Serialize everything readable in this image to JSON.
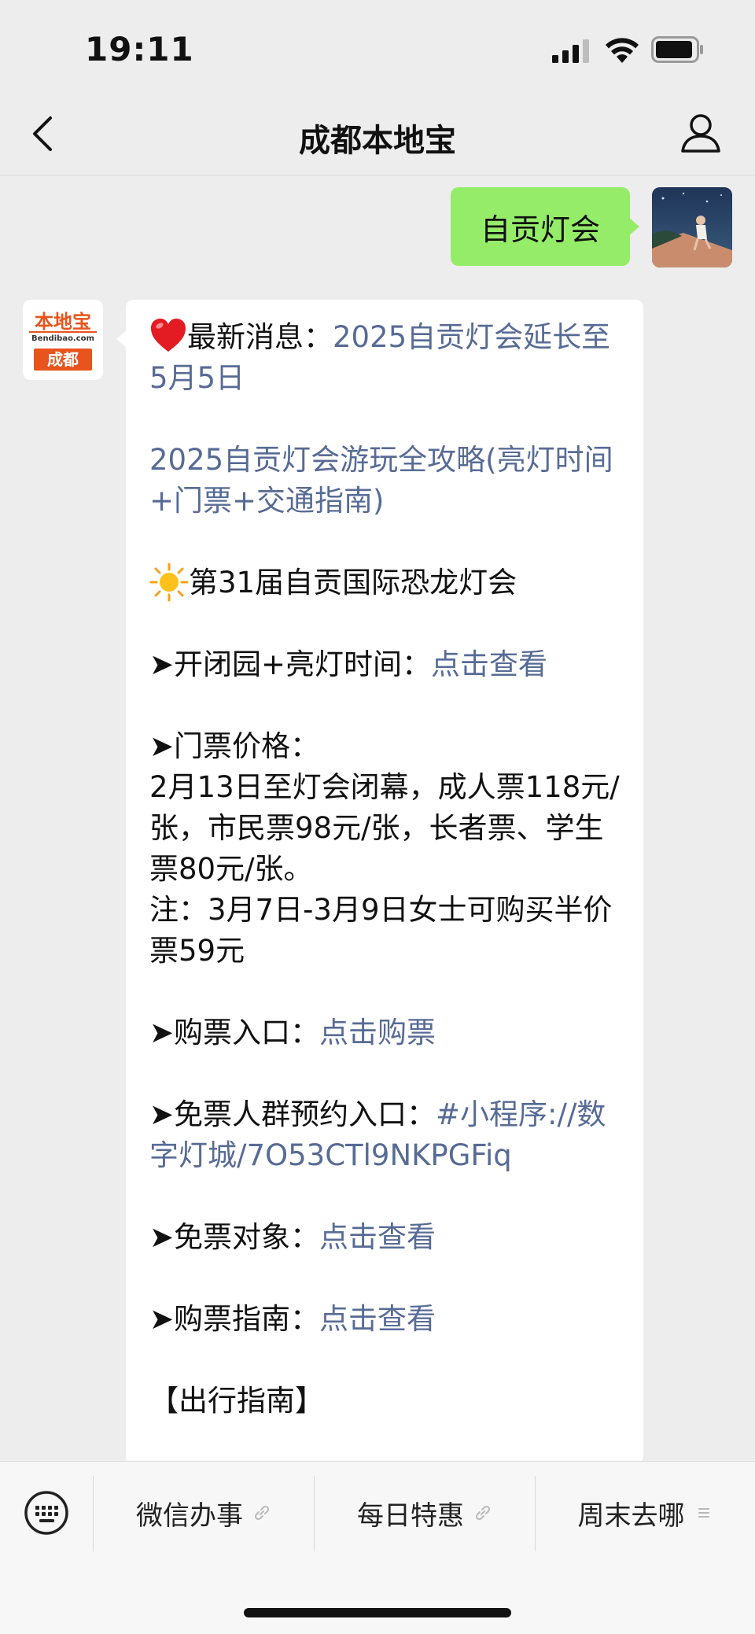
{
  "status": {
    "time": "19:11"
  },
  "nav": {
    "title": "成都本地宝"
  },
  "outgoing": {
    "text": "自贡灯会"
  },
  "bot": {
    "logo_name": "本地宝",
    "logo_url": "Bendibao.com",
    "logo_city": "成都"
  },
  "message": {
    "news_label": "最新消息：",
    "news_link": "2025自贡灯会延长至5月5日",
    "guide_link": "2025自贡灯会游玩全攻略(亮灯时间+门票+交通指南)",
    "festival_title": "第31届自贡国际恐龙灯会",
    "hours_label": "开闭园+亮灯时间：",
    "hours_link": "点击查看",
    "price_label": "门票价格：",
    "price_text": "2月13日至灯会闭幕，成人票118元/张，市民票98元/张，长者票、学生票80元/张。",
    "price_note": "注：3月7日-3月9日女士可购买半价票59元",
    "buy_label": "购票入口：",
    "buy_link": "点击购票",
    "free_reserve_label": "免票人群预约入口：",
    "free_reserve_link": "#小程序://数字灯城/7O53CTl9NKPGFiq",
    "free_target_label": "免票对象：",
    "free_target_link": "点击查看",
    "buy_guide_label": "购票指南：",
    "buy_guide_link": "点击查看",
    "travel_heading": "【出行指南】"
  },
  "bottom_menu": [
    {
      "label": "微信办事",
      "icon": "link-icon"
    },
    {
      "label": "每日特惠",
      "icon": "link-icon"
    },
    {
      "label": "周末去哪",
      "icon": "menu-lines-icon"
    }
  ],
  "colors": {
    "link": "#576b95",
    "outgoing_bubble": "#95ec69",
    "brand": "#e8541c"
  }
}
